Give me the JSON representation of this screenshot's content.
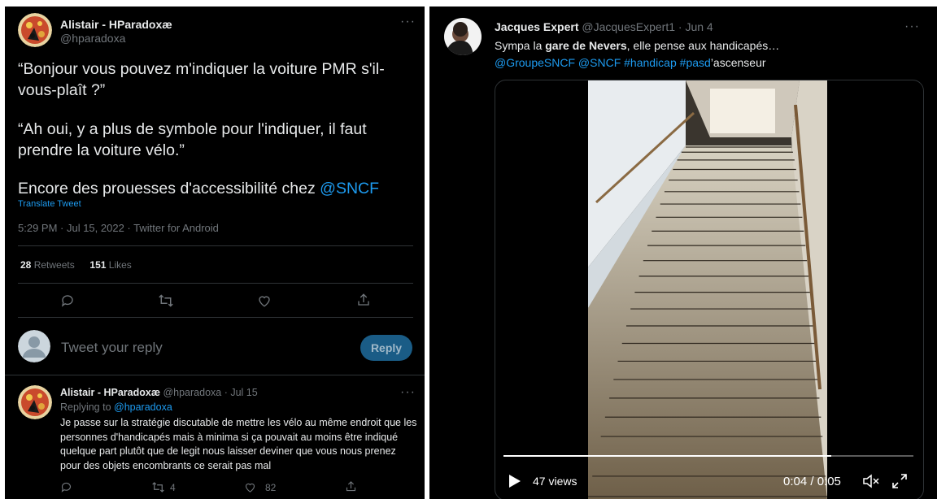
{
  "main_tweet": {
    "author_name": "Alistair - HParadoxæ",
    "author_handle": "@hparadoxa",
    "para1": "“Bonjour vous pouvez m'indiquer la voiture PMR s'il-vous-plaît ?”",
    "para2": "“Ah oui, y a plus de symbole pour l'indiquer, il faut prendre la voiture vélo.”",
    "para3_text": "Encore des prouesses d'accessibilité chez ",
    "para3_mention": "@SNCF",
    "translate_label": "Translate Tweet",
    "meta": "5:29 PM · Jul 15, 2022 · Twitter for Android",
    "retweets_count": "28",
    "retweets_label": "Retweets",
    "likes_count": "151",
    "likes_label": "Likes"
  },
  "composer": {
    "placeholder": "Tweet your reply",
    "reply_button": "Reply"
  },
  "reply_tweet": {
    "author_name": "Alistair - HParadoxæ",
    "author_handle": "@hparadoxa",
    "date": "· Jul 15",
    "replying_label": "Replying to ",
    "replying_handle": "@hparadoxa",
    "text": "Je passe sur la stratégie discutable de mettre les vélo au même endroit que les personnes d'handicapés mais à minima si ça pouvait au moins être indiqué quelque part plutôt que de legit nous laisser deviner que vous nous prenez pour des objets encombrants ce serait pas mal",
    "retweets": "4",
    "likes": "82"
  },
  "right_tweet": {
    "author_name": "Jacques Expert",
    "author_handle": "@JacquesExpert1",
    "date": "· Jun 4",
    "text_1": "Sympa la ",
    "text_bold": "gare de Nevers",
    "text_2": ", elle pense aux handicapés…",
    "mention_1": "@GroupeSNCF",
    "mention_2": "@SNCF",
    "hashtag_1": "#handicap",
    "hashtag_2": "#pasd",
    "text_3": "’ascenseur",
    "views": "47 views",
    "time_display": "0:04 / 0:05",
    "progress": 0.8
  },
  "icons": [
    "more-icon",
    "reply-icon",
    "retweet-icon",
    "like-icon",
    "share-icon",
    "play-icon",
    "mute-icon",
    "fullscreen-icon"
  ]
}
